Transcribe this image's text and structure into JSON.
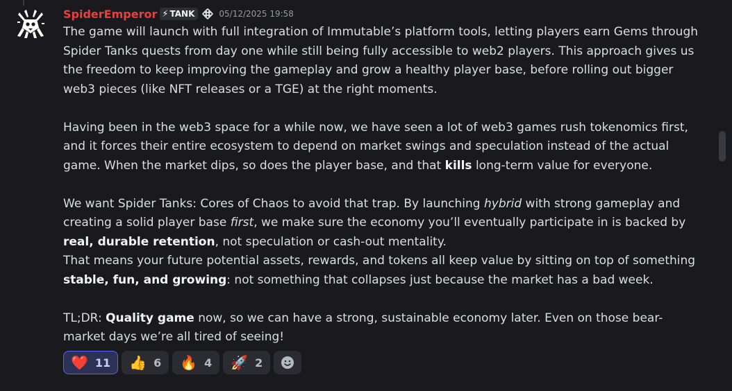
{
  "message": {
    "author": "SpiderEmperor",
    "author_color": "#e8403d",
    "tag": "TANK",
    "tag_icon": "lightning-bolt-icon",
    "guild_icon": "dice-icon",
    "timestamp": "05/12/2025 19:58",
    "paragraphs": {
      "p1": "The game will launch with full integration of Immutable’s platform tools, letting players earn Gems through Spider Tanks quests from day one while still being fully accessible to web2 players. This approach gives us the freedom to keep improving the gameplay and grow a healthy player base, before rolling out bigger web3 pieces (like NFT releases or a TGE) at the right moments.",
      "p2_a": "Having been in the web3 space for a while now, we have seen a lot of web3 games rush tokenomics first, and it forces their entire ecosystem to depend on market swings and speculation instead of the actual game. When the market dips, so does the player base, and that ",
      "p2_bold": "kills",
      "p2_b": " long-term value for everyone.",
      "p3_a": "We want Spider Tanks: Cores of Chaos to avoid that trap. By launching ",
      "p3_italic1": "hybrid",
      "p3_b": " with strong gameplay and creating a solid player base ",
      "p3_italic2": "first",
      "p3_c": ", we make sure the economy you’ll eventually participate in is backed by ",
      "p3_bold": "real, durable retention",
      "p3_d": ", not speculation or cash-out mentality.",
      "p4_a": "That means your future potential assets, rewards, and tokens all keep value by sitting on top of something ",
      "p4_bold": "stable, fun, and growing",
      "p4_b": ": not something that collapses just because the market has a bad week.",
      "p5_a": "TL;DR: ",
      "p5_bold": "Quality game",
      "p5_b": " now, so we can have a strong, sustainable economy later. Even on those bear-market days we’re all tired of seeing!"
    }
  },
  "reactions": [
    {
      "emoji": "❤️",
      "icon": "red-heart-icon",
      "count": "11",
      "active": true
    },
    {
      "emoji": "👍",
      "icon": "thumbs-up-icon",
      "count": "6",
      "active": false
    },
    {
      "emoji": "🔥",
      "icon": "fire-icon",
      "count": "4",
      "active": false
    },
    {
      "emoji": "🚀",
      "icon": "rocket-icon",
      "count": "2",
      "active": false
    }
  ],
  "add_reaction_icon": "smiley-add-reaction-icon",
  "colors": {
    "background": "#1a1a1e",
    "text": "#dbdee1",
    "timestamp": "#949ba4",
    "active_reaction_border": "#5865f2"
  }
}
